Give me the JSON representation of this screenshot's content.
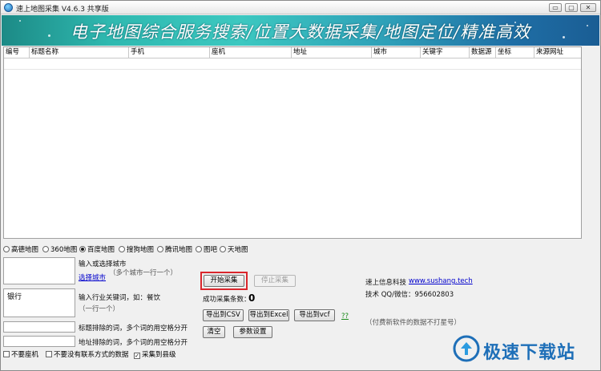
{
  "window": {
    "title": "速上地图采集 V4.6.3 共享版",
    "controls": {
      "minimize": "▭",
      "maximize": "▢",
      "close": "✕"
    }
  },
  "banner": {
    "text": "电子地图综合服务搜索/位置大数据采集/地图定位/精准高效"
  },
  "table": {
    "columns": [
      "编号",
      "标题名称",
      "手机",
      "座机",
      "地址",
      "城市",
      "关键字",
      "数据源",
      "坐标",
      "来源网址"
    ]
  },
  "sources": {
    "options": [
      "高德地图",
      "360地图",
      "百度地图",
      "搜狗地图",
      "腾讯地图",
      "图吧",
      "天地图"
    ],
    "selected": "百度地图"
  },
  "city": {
    "value": "",
    "label": "输入或选择城市",
    "hint": "（多个城市一行一个）",
    "select_link": "选择城市"
  },
  "keyword": {
    "value": "银行",
    "label": "输入行业关键词，如：餐饮",
    "hint": "（一行一个）"
  },
  "title_exclude": {
    "value": "",
    "label": "标题排除的词，多个词的用空格分开"
  },
  "address_exclude": {
    "value": "",
    "label": "地址排除的词，多个词的用空格分开"
  },
  "checkboxes": [
    {
      "label": "不要座机",
      "checked": false
    },
    {
      "label": "不要没有联系方式的数据",
      "checked": false
    },
    {
      "label": "采集到县级",
      "checked": true
    }
  ],
  "actions": {
    "start": "开始采集",
    "stop": "停止采集",
    "success_label": "成功采集条数：",
    "success_count": "0",
    "export_csv": "导出到CSV",
    "export_excel": "导出到Excel",
    "export_vcf": "导出到vcf",
    "help": "??",
    "clear": "清空",
    "settings": "参数设置"
  },
  "company": {
    "name": "速上信息科技",
    "website": "www.sushang.tech",
    "contact": "技术 QQ/微信：956602803",
    "note": "（付费新软件的数据不打星号）"
  },
  "watermark": {
    "text": "极速下载站"
  }
}
